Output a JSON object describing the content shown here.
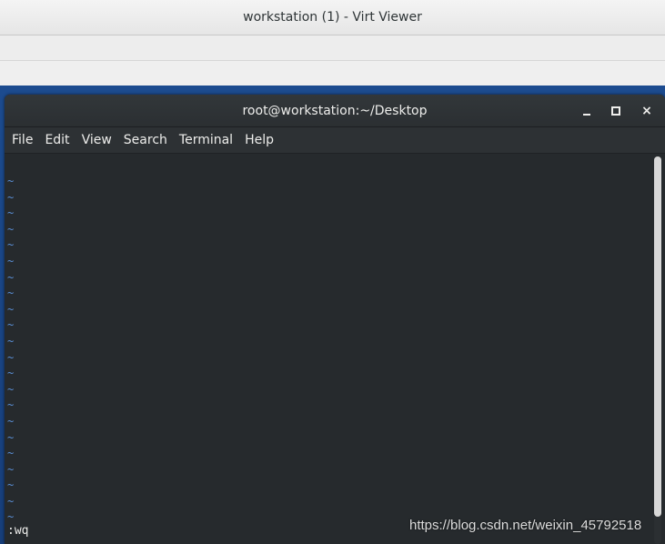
{
  "outer_window": {
    "title": "workstation (1) - Virt Viewer"
  },
  "terminal": {
    "title": "root@workstation:~/Desktop",
    "menu": [
      "File",
      "Edit",
      "View",
      "Search",
      "Terminal",
      "Help"
    ],
    "window_controls": {
      "minimize_icon": "minimize-icon",
      "maximize_icon": "maximize-icon",
      "close": "×"
    },
    "empty_line_marker": "~",
    "empty_line_count": 22,
    "command_line": ":wq"
  },
  "watermark": "https://blog.csdn.net/weixin_45792518",
  "colors": {
    "desktop": "#1c4b8f",
    "terminal_bg": "#262a2d",
    "tilde": "#5a8fd6",
    "text": "#eeeeec"
  }
}
